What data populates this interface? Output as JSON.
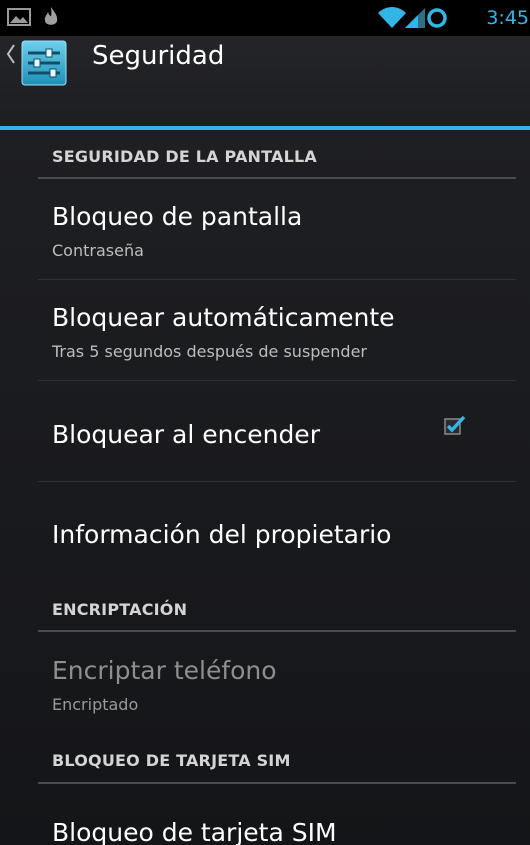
{
  "status_bar": {
    "time": "3:45",
    "icons": [
      "gallery-icon",
      "fire-icon",
      "wifi-icon",
      "signal-icon",
      "sync-icon"
    ],
    "time_color": "#33b5e5"
  },
  "action_bar": {
    "title": "Seguridad",
    "icon": "settings-sliders-icon",
    "accent_color": "#33b5e5"
  },
  "sections": [
    {
      "header": "SEGURIDAD DE LA PANTALLA",
      "items": [
        {
          "title": "Bloqueo de pantalla",
          "subtitle": "Contraseña"
        },
        {
          "title": "Bloquear automáticamente",
          "subtitle": "Tras 5 segundos después de suspender"
        },
        {
          "title": "Bloquear al encender",
          "checked": true
        },
        {
          "title": "Información del propietario"
        }
      ]
    },
    {
      "header": "ENCRIPTACIÓN",
      "items": [
        {
          "title": "Encriptar teléfono",
          "subtitle": "Encriptado",
          "disabled": true
        }
      ]
    },
    {
      "header": "BLOQUEO DE TARJETA SIM",
      "items": [
        {
          "title": "Bloqueo de tarjeta SIM"
        }
      ]
    }
  ]
}
